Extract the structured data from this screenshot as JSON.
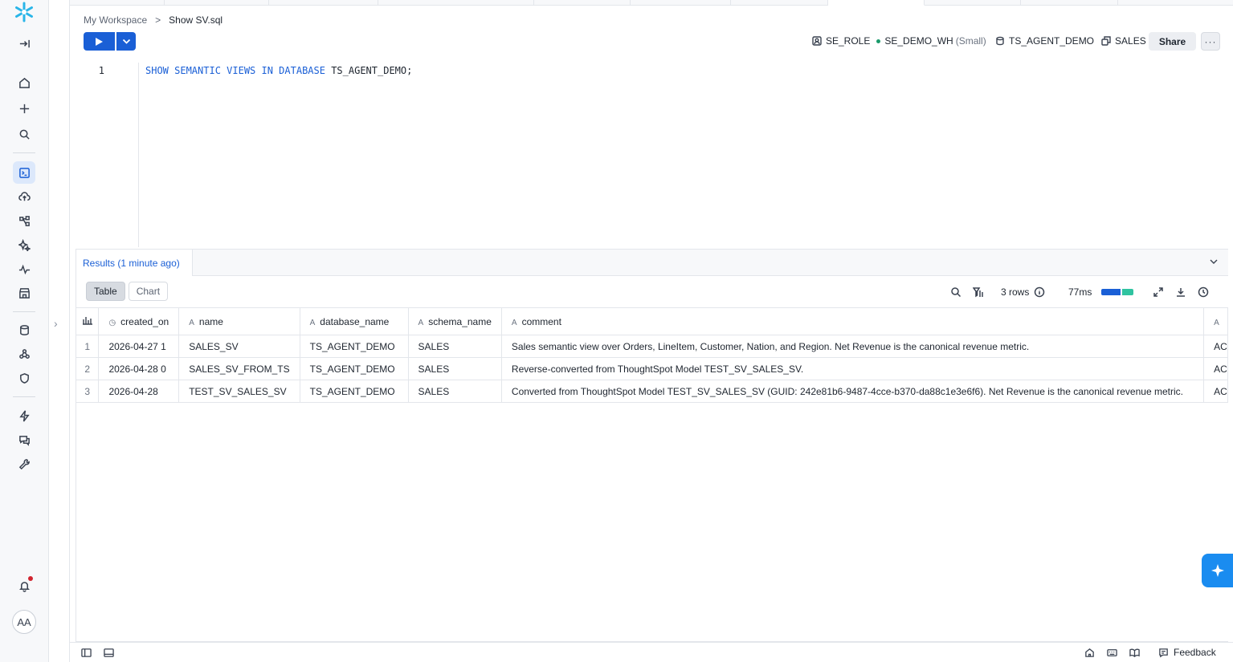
{
  "breadcrumb": {
    "workspace": "My Workspace",
    "separator": ">",
    "file": "Show SV.sql"
  },
  "context": {
    "role": "SE_ROLE",
    "warehouse": "SE_DEMO_WH",
    "warehouse_size": "(Small)",
    "database": "TS_AGENT_DEMO",
    "schema": "SALES"
  },
  "toolbar": {
    "share_label": "Share",
    "more_label": "···"
  },
  "editor": {
    "line_number": "1",
    "code_keywords": "SHOW SEMANTIC VIEWS IN DATABASE",
    "code_rest": " TS_AGENT_DEMO;"
  },
  "results": {
    "tab_label": "Results",
    "tab_time": "(1 minute ago)",
    "view_table": "Table",
    "view_chart": "Chart",
    "row_count": "3 rows",
    "duration": "77ms",
    "columns": [
      "created_on",
      "name",
      "database_name",
      "schema_name",
      "comment",
      "A"
    ],
    "rows": [
      [
        "1",
        "2026-04-27 1",
        "SALES_SV",
        "TS_AGENT_DEMO",
        "SALES",
        "Sales semantic view over Orders, LineItem, Customer, Nation, and Region. Net Revenue is the canonical revenue metric.",
        "AC"
      ],
      [
        "2",
        "2026-04-28 0",
        "SALES_SV_FROM_TS",
        "TS_AGENT_DEMO",
        "SALES",
        "Reverse-converted from ThoughtSpot Model TEST_SV_SALES_SV.",
        "AC"
      ],
      [
        "3",
        "2026-04-28",
        "TEST_SV_SALES_SV",
        "TS_AGENT_DEMO",
        "SALES",
        "Converted from ThoughtSpot Model TEST_SV_SALES_SV (GUID: 242e81b6-9487-4cce-b370-da88c1e3e6f6). Net Revenue is the canonical revenue metric.",
        "AC"
      ]
    ]
  },
  "user": {
    "initials": "AA"
  },
  "footer": {
    "feedback_label": "Feedback"
  },
  "colors": {
    "accent": "#1a5fd6",
    "success": "#1a9a6b",
    "copilot": "#1a8cf0"
  }
}
